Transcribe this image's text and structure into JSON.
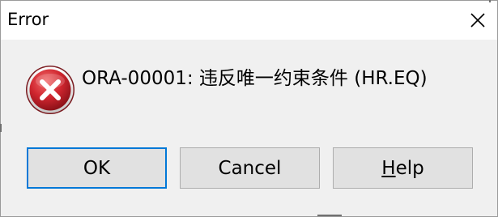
{
  "window": {
    "title": "Error",
    "close_icon": "close-icon"
  },
  "message": {
    "icon": "error-icon",
    "text": "ORA-00001: 违反唯一约束条件 (HR.EQ)"
  },
  "buttons": {
    "ok_label": "OK",
    "cancel_label": "Cancel",
    "help_mnemonic": "H",
    "help_rest": "elp"
  },
  "colors": {
    "focus_border": "#0078d7",
    "error_red": "#c4262e",
    "dialog_bg": "#f0f0f0"
  }
}
